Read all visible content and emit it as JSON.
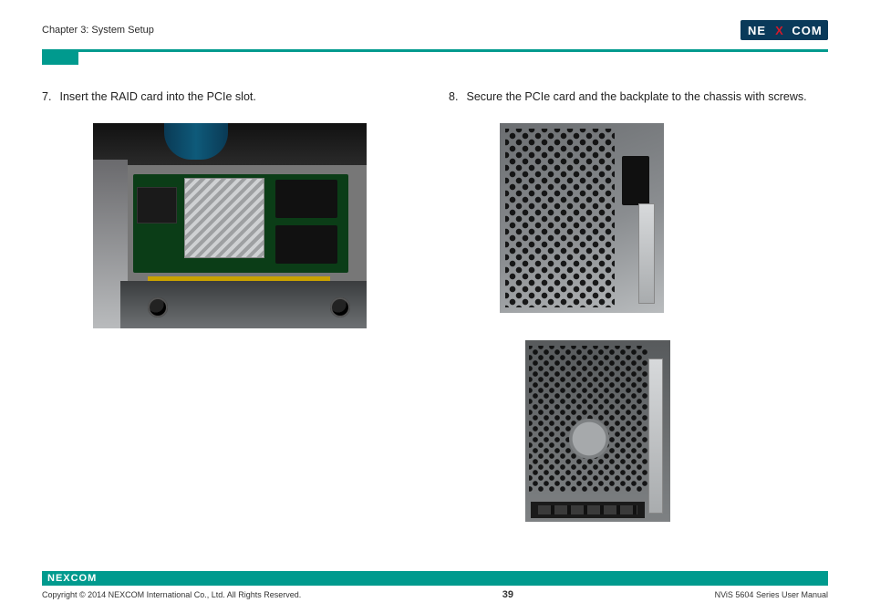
{
  "header": {
    "chapter": "Chapter 3: System Setup",
    "logo": {
      "left": "NE",
      "mid": "X",
      "right": "COM"
    }
  },
  "steps": {
    "left": {
      "num": "7.",
      "text": "Insert the RAID card into the PCIe slot."
    },
    "right": {
      "num": "8.",
      "text": "Secure the PCIe card and the backplate to the chassis with screws."
    }
  },
  "footer": {
    "logo_text": "NEXCOM",
    "copyright": "Copyright © 2014 NEXCOM International Co., Ltd. All Rights Reserved.",
    "page": "39",
    "manual": "NViS 5604 Series User Manual"
  }
}
